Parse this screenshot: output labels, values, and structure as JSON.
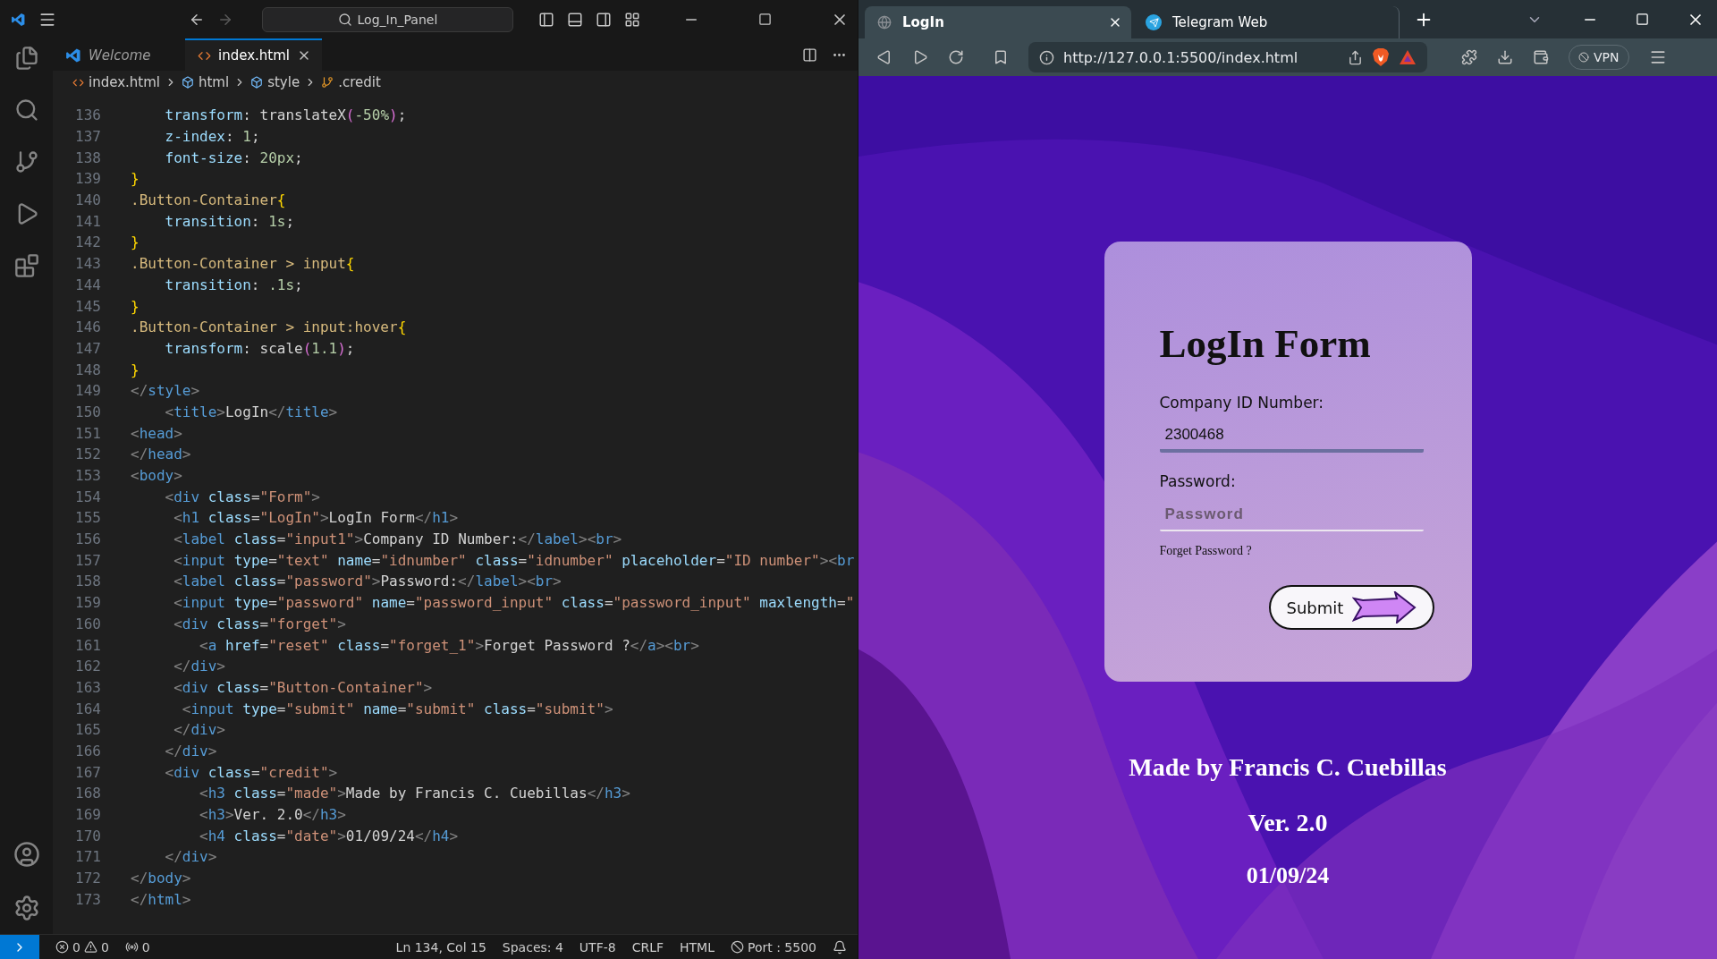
{
  "editor": {
    "title_search": "Log_In_Panel",
    "tabs": [
      {
        "label": "Welcome",
        "kind": "welcome",
        "selected": false
      },
      {
        "label": "index.html",
        "kind": "html",
        "selected": true
      }
    ],
    "breadcrumbs": [
      {
        "label": "index.html",
        "kind": "file"
      },
      {
        "label": "html",
        "kind": "element"
      },
      {
        "label": "style",
        "kind": "element"
      },
      {
        "label": ".credit",
        "kind": "selector"
      }
    ],
    "lines": [
      {
        "number": "136",
        "kind": "css",
        "text": "    transform: translateX(-50%);"
      },
      {
        "number": "137",
        "kind": "css",
        "text": "    z-index: 1;"
      },
      {
        "number": "138",
        "kind": "css",
        "text": "    font-size: 20px;"
      },
      {
        "number": "139",
        "kind": "css",
        "text": "}"
      },
      {
        "number": "140",
        "kind": "css",
        "text": ".Button-Container{"
      },
      {
        "number": "141",
        "kind": "css",
        "text": "    transition: 1s;"
      },
      {
        "number": "142",
        "kind": "css",
        "text": "}"
      },
      {
        "number": "143",
        "kind": "css",
        "text": ".Button-Container > input{"
      },
      {
        "number": "144",
        "kind": "css",
        "text": "    transition: .1s;"
      },
      {
        "number": "145",
        "kind": "css",
        "text": "}"
      },
      {
        "number": "146",
        "kind": "css",
        "text": ".Button-Container > input:hover{"
      },
      {
        "number": "147",
        "kind": "css",
        "text": "    transform: scale(1.1);"
      },
      {
        "number": "148",
        "kind": "css",
        "text": "}"
      },
      {
        "number": "149",
        "kind": "html",
        "text": "</style>"
      },
      {
        "number": "150",
        "kind": "html",
        "text": "    <title>LogIn</title>"
      },
      {
        "number": "151",
        "kind": "html",
        "text": "<head>"
      },
      {
        "number": "152",
        "kind": "html",
        "text": "</head>"
      },
      {
        "number": "153",
        "kind": "html",
        "text": "<body>"
      },
      {
        "number": "154",
        "kind": "html",
        "text": "    <div class=\"Form\">"
      },
      {
        "number": "155",
        "kind": "html",
        "text": "     <h1 class=\"LogIn\">LogIn Form</h1>"
      },
      {
        "number": "156",
        "kind": "html",
        "text": "     <label class=\"input1\">Company ID Number:</label><br>"
      },
      {
        "number": "157",
        "kind": "html",
        "text": "     <input type=\"text\" name=\"idnumber\" class=\"idnumber\" placeholder=\"ID number\"><br"
      },
      {
        "number": "158",
        "kind": "html",
        "text": "     <label class=\"password\">Password:</label><br>"
      },
      {
        "number": "159",
        "kind": "html",
        "text": "     <input type=\"password\" name=\"password_input\" class=\"password_input\" maxlength=\""
      },
      {
        "number": "160",
        "kind": "html",
        "text": "     <div class=\"forget\">"
      },
      {
        "number": "161",
        "kind": "html",
        "text": "        <a href=\"reset\" class=\"forget_1\">Forget Password ?</a><br>"
      },
      {
        "number": "162",
        "kind": "html",
        "text": "     </div>"
      },
      {
        "number": "163",
        "kind": "html",
        "text": "     <div class=\"Button-Container\">"
      },
      {
        "number": "164",
        "kind": "html",
        "text": "      <input type=\"submit\" name=\"submit\" class=\"submit\">"
      },
      {
        "number": "165",
        "kind": "html",
        "text": "     </div>"
      },
      {
        "number": "166",
        "kind": "html",
        "text": "    </div>"
      },
      {
        "number": "167",
        "kind": "html",
        "text": "    <div class=\"credit\">"
      },
      {
        "number": "168",
        "kind": "html",
        "text": "        <h3 class=\"made\">Made by Francis C. Cuebillas</h3>"
      },
      {
        "number": "169",
        "kind": "html",
        "text": "        <h3>Ver. 2.0</h3>"
      },
      {
        "number": "170",
        "kind": "html",
        "text": "        <h4 class=\"date\">01/09/24</h4>"
      },
      {
        "number": "171",
        "kind": "html",
        "text": "    </div>"
      },
      {
        "number": "172",
        "kind": "html",
        "text": "</body>"
      },
      {
        "number": "173",
        "kind": "html",
        "text": "</html>"
      }
    ],
    "status_bar": {
      "errors": "0",
      "warnings": "0",
      "ports": "0",
      "items": [
        "Ln 134, Col 15",
        "Spaces: 4",
        "UTF-8",
        "CRLF",
        "HTML"
      ],
      "port": "Port : 5500"
    }
  },
  "browser": {
    "tabs": [
      {
        "label": "LogIn",
        "kind": "page",
        "selected": true
      },
      {
        "label": "Telegram Web",
        "kind": "telegram",
        "selected": false
      }
    ],
    "url": "http://127.0.0.1:5500/index.html",
    "vpn": "VPN",
    "page": {
      "form": {
        "title": "LogIn Form",
        "fields": [
          {
            "label": "Company ID Number:",
            "value": "2300468",
            "focused": true
          },
          {
            "label": "Password:",
            "placeholder": "Password",
            "focused": false
          }
        ],
        "forgot_link": "Forget Password ?",
        "submit": "Submit"
      },
      "credits": [
        {
          "text": "Made by Francis C. Cuebillas",
          "kind": "h3"
        },
        {
          "text": "Ver. 2.0",
          "kind": "h3"
        },
        {
          "text": "01/09/24",
          "kind": "h4"
        }
      ]
    }
  }
}
